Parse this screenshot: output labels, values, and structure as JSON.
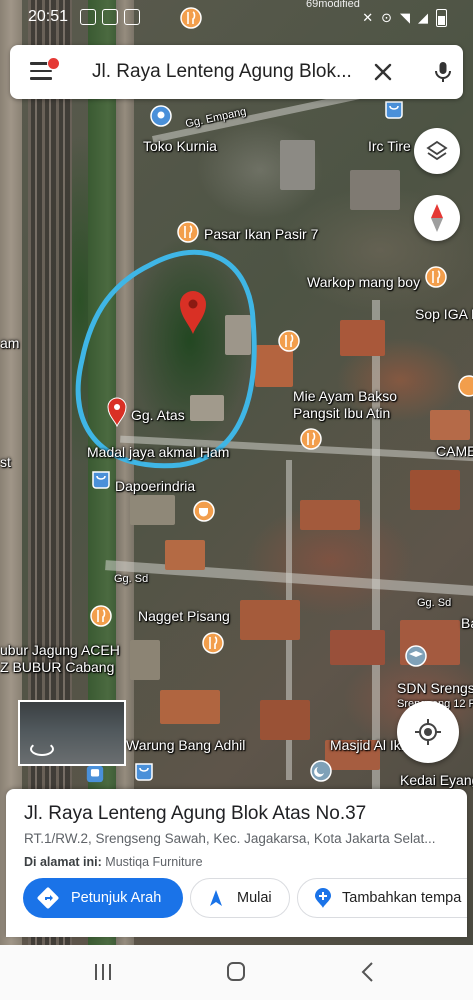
{
  "status_bar": {
    "time": "20:51",
    "partial_text": "69modified"
  },
  "search": {
    "query": "Jl. Raya Lenteng Agung Blok..."
  },
  "map": {
    "labels": {
      "gg_empang": "Gg. Empang",
      "toko_kurnia": "Toko Kurnia",
      "irc_tire": "Irc Tire",
      "pasar_ikan": "Pasar Ikan Pasir 7",
      "warkop": "Warkop mang boy",
      "sop_iga": "Sop IGA B",
      "am": "am",
      "mie_ayam_1": "Mie Ayam Bakso",
      "mie_ayam_2": "Pangsit Ibu Atin",
      "gg_atas": "Gg. Atas",
      "madal": "Madal jaya akmal Ham",
      "st": "st",
      "came": "CAME",
      "dapoerindria": "Dapoerindria",
      "gg_sd_1": "Gg. Sd",
      "gg_sd_2": "Gg. Sd",
      "nagget": "Nagget Pisang",
      "bubur_1": "ubur Jagung ACEH",
      "bubur_2": "Z BUBUR Cabang",
      "ba": "Ba",
      "sdn_1": "SDN Srengs",
      "sdn_2": "Srengseng 12 P",
      "warung": "Warung Bang Adhil",
      "masjid": "Masjid Al Ikhw",
      "kedai": "Kedai Eyang"
    },
    "accent_circle_color": "#3fb6e6",
    "pin_color": "#d93025",
    "poi_color": "#f29e4c"
  },
  "place_card": {
    "title": "Jl. Raya Lenteng Agung Blok Atas No.37",
    "subtitle": "RT.1/RW.2, Srengseng Sawah, Kec. Jagakarsa, Kota Jakarta Selat...",
    "at_label": "Di alamat ini:",
    "at_value": "Mustiqa Furniture",
    "directions_label": "Petunjuk Arah",
    "start_label": "Mulai",
    "add_label": "Tambahkan tempa",
    "accent_color": "#1a73e8"
  }
}
